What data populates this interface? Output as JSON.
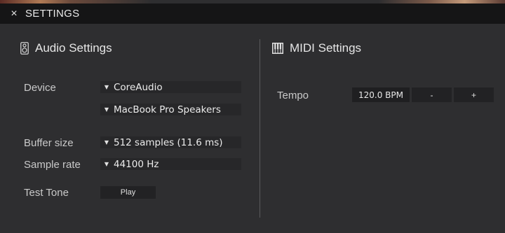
{
  "window": {
    "close_glyph": "×",
    "title": "SETTINGS"
  },
  "audio": {
    "title": "Audio Settings",
    "icon": "speaker-icon",
    "device_label": "Device",
    "device_driver": "CoreAudio",
    "device_output": "MacBook Pro Speakers",
    "buffer_label": "Buffer size",
    "buffer_value": "512 samples (11.6 ms)",
    "samplerate_label": "Sample rate",
    "samplerate_value": "44100 Hz",
    "testtone_label": "Test Tone",
    "play_label": "Play"
  },
  "midi": {
    "title": "MIDI Settings",
    "icon": "piano-keys-icon",
    "tempo_label": "Tempo",
    "tempo_value": "120.0 BPM",
    "minus_label": "-",
    "plus_label": "+"
  },
  "colors": {
    "background": "#2e2e30",
    "titlebar": "#151516",
    "control": "#272729",
    "text": "#d8d8d8"
  }
}
